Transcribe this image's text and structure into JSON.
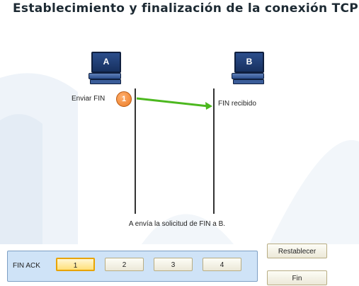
{
  "title": "Establecimiento y finalización de la conexión TCP",
  "host_a": {
    "letter": "A",
    "label": "Enviar FIN"
  },
  "host_b": {
    "letter": "B",
    "label": "FIN recibido"
  },
  "step_badge": "1",
  "caption": "A envía la solicitud de FIN a B.",
  "controls": {
    "label": "FIN ACK",
    "steps": [
      "1",
      "2",
      "3",
      "4"
    ],
    "active_step": "1"
  },
  "buttons": {
    "reset": "Restablecer",
    "end": "Fin"
  },
  "colors": {
    "arrow": "#4cb81f",
    "badge": "#ec7a22",
    "timeline": "#333333",
    "accent_border": "#e8a400"
  }
}
